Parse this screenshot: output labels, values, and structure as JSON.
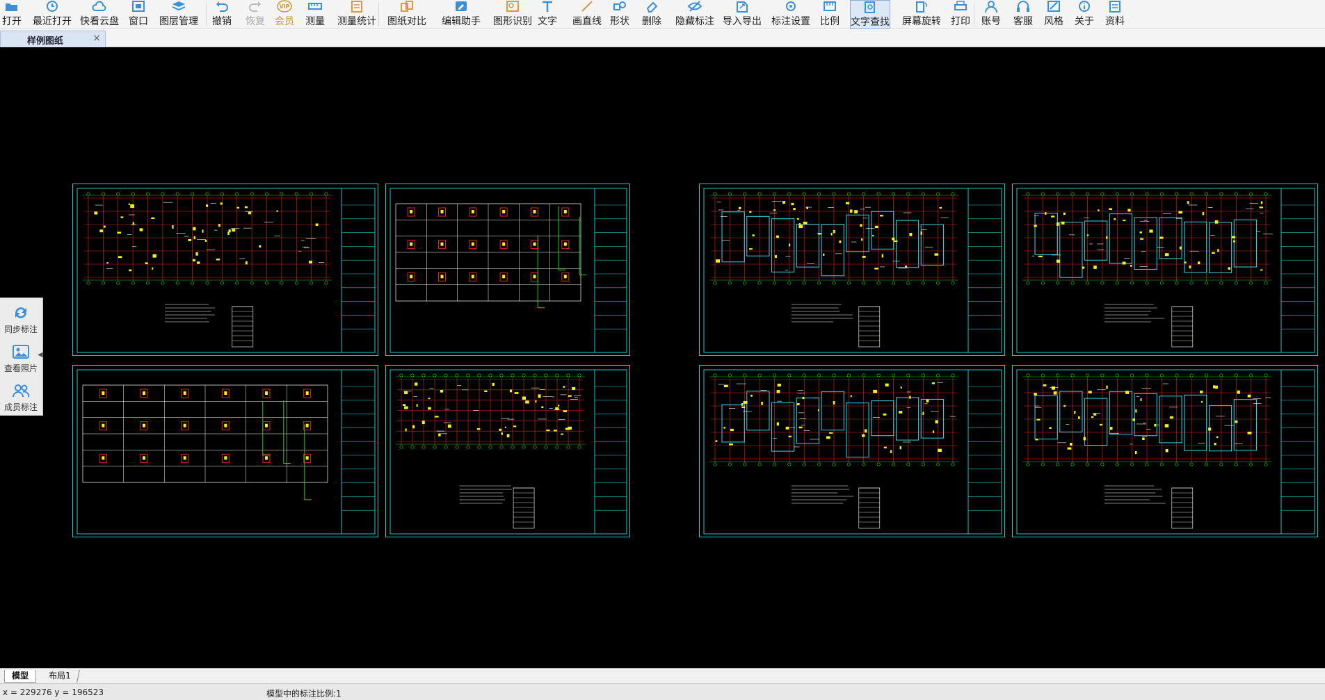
{
  "toolbar": {
    "items": [
      {
        "label": "打开",
        "icon": "folder-open-icon"
      },
      {
        "label": "最近打开",
        "icon": "clock-history-icon"
      },
      {
        "label": "快看云盘",
        "icon": "cloud-icon"
      },
      {
        "label": "窗口",
        "icon": "window-icon"
      },
      {
        "label": "图层管理",
        "icon": "layers-icon"
      },
      {
        "label": "撤销",
        "icon": "undo-icon"
      },
      {
        "label": "恢复",
        "icon": "redo-icon"
      },
      {
        "label": "会员",
        "icon": "vip-icon",
        "icon_text": "VIP"
      },
      {
        "label": "测量",
        "icon": "ruler-icon"
      },
      {
        "label": "测量统计",
        "icon": "measure-stats-icon"
      },
      {
        "label": "图纸对比",
        "icon": "compare-icon"
      },
      {
        "label": "编辑助手",
        "icon": "edit-helper-icon"
      },
      {
        "label": "图形识别",
        "icon": "shape-recognize-icon"
      },
      {
        "label": "文字",
        "icon": "text-icon"
      },
      {
        "label": "画直线",
        "icon": "line-icon"
      },
      {
        "label": "形状",
        "icon": "shape-icon"
      },
      {
        "label": "删除",
        "icon": "eraser-icon"
      },
      {
        "label": "隐藏标注",
        "icon": "eye-hide-icon"
      },
      {
        "label": "导入导出",
        "icon": "import-export-icon"
      },
      {
        "label": "标注设置",
        "icon": "annotation-settings-icon"
      },
      {
        "label": "比例",
        "icon": "scale-icon"
      },
      {
        "label": "文字查找",
        "icon": "text-search-icon"
      },
      {
        "label": "屏幕旋转",
        "icon": "rotate-screen-icon"
      },
      {
        "label": "打印",
        "icon": "printer-icon"
      },
      {
        "label": "账号",
        "icon": "user-icon"
      },
      {
        "label": "客服",
        "icon": "headset-icon"
      },
      {
        "label": "风格",
        "icon": "style-icon"
      },
      {
        "label": "关于",
        "icon": "info-icon"
      },
      {
        "label": "资料",
        "icon": "documents-icon"
      }
    ],
    "active_label": "文字查找",
    "disabled_label": "恢复"
  },
  "tabs": {
    "active": {
      "label": "样例图纸",
      "close": "×"
    }
  },
  "side_panel": {
    "items": [
      {
        "label": "同步标注",
        "icon": "sync-icon"
      },
      {
        "label": "查看照片",
        "icon": "photo-icon"
      },
      {
        "label": "成员标注",
        "icon": "members-icon"
      }
    ],
    "collapse": "◀"
  },
  "drawing": {
    "sheets_count": 8,
    "colors": {
      "frame": "#25c7c7",
      "grid_red": "#e02525",
      "axis_green": "#1fd11f",
      "annotation_yellow": "#f2f21a",
      "text_white": "#ffffff"
    }
  },
  "layout_tabs": [
    {
      "label": "模型"
    },
    {
      "label": "布局1"
    }
  ],
  "status": {
    "coords": "x = 229276 y = 196523",
    "scale": "模型中的标注比例:1"
  }
}
